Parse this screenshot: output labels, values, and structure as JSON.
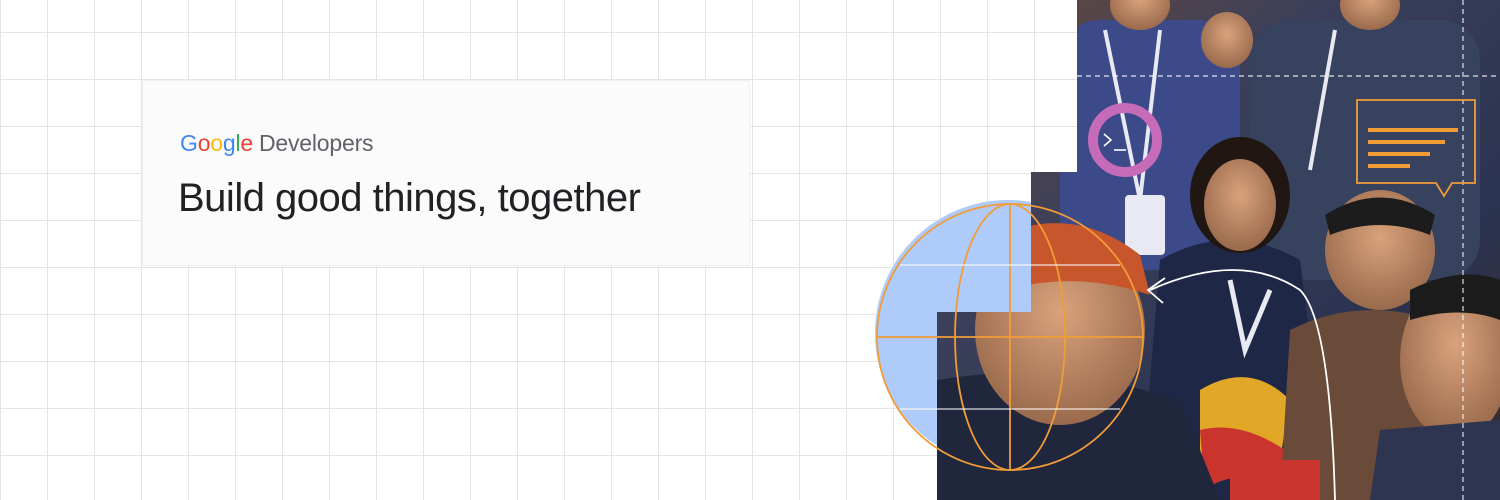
{
  "brand": {
    "logo_letters": [
      {
        "char": "G",
        "color": "#4285F4"
      },
      {
        "char": "o",
        "color": "#EA4335"
      },
      {
        "char": "o",
        "color": "#FBBC05"
      },
      {
        "char": "g",
        "color": "#4285F4"
      },
      {
        "char": "l",
        "color": "#34A853"
      },
      {
        "char": "e",
        "color": "#EA4335"
      }
    ],
    "subtitle": "Developers"
  },
  "headline": "Build good things, together",
  "colors": {
    "globe_fill": "#AECBFA",
    "accent_orange": "#F29C38",
    "grid_line": "#E5E5E5"
  }
}
